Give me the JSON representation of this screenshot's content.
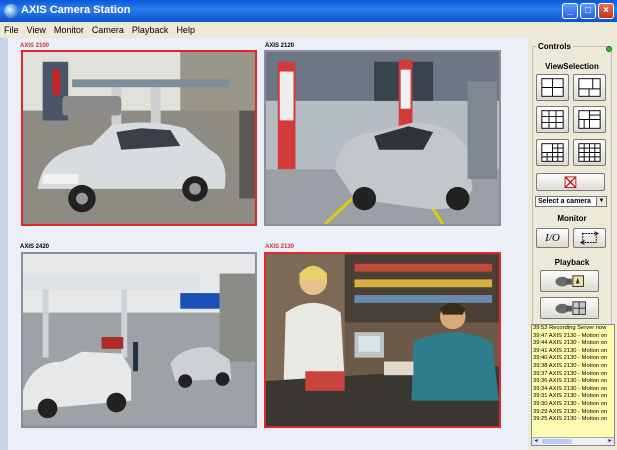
{
  "window": {
    "title": "AXIS Camera Station"
  },
  "menu": [
    "File",
    "View",
    "Monitor",
    "Camera",
    "Playback",
    "Help"
  ],
  "cameras": [
    {
      "label": "AXIS 2100",
      "label_color": "#d43030",
      "alert": true
    },
    {
      "label": "AXIS 2120",
      "label_color": "#000000",
      "alert": false
    },
    {
      "label": "AXIS 2420",
      "label_color": "#000000",
      "alert": false
    },
    {
      "label": "AXIS 2130",
      "label_color": "#d43030",
      "alert": true
    }
  ],
  "controls": {
    "title": "Controls",
    "view_selection": "ViewSelection",
    "camera_select": "Select a camera",
    "monitor": "Monitor",
    "io_label": "I/O",
    "playback": "Playback"
  },
  "log": [
    "39:53 Recording Server now",
    "39:47 AXIS 2130 - Motion on",
    "39:44 AXIS 2130 - Motion on",
    "39:41 AXIS 2130 - Motion on",
    "39:40 AXIS 2130 - Motion on",
    "39:38 AXIS 2130 - Motion on",
    "39:37 AXIS 2130 - Motion on",
    "39:36 AXIS 2130 - Motion on",
    "39:34 AXIS 2130 - Motion on",
    "39:31 AXIS 2130 - Motion on",
    "39:30 AXIS 2130 - Motion on",
    "39:29 AXIS 2130 - Motion on",
    "39:25 AXIS 2130 - Motion on"
  ],
  "icons": [
    "app-icon",
    "minimize-icon",
    "maximize-icon",
    "close-icon",
    "delete-view-icon",
    "playback-camera-icon",
    "playback-grid-icon"
  ],
  "colors": {
    "alert_border": "#e02a2a",
    "log_bg": "#fffbb0",
    "title_blue": "#0a58d8"
  }
}
